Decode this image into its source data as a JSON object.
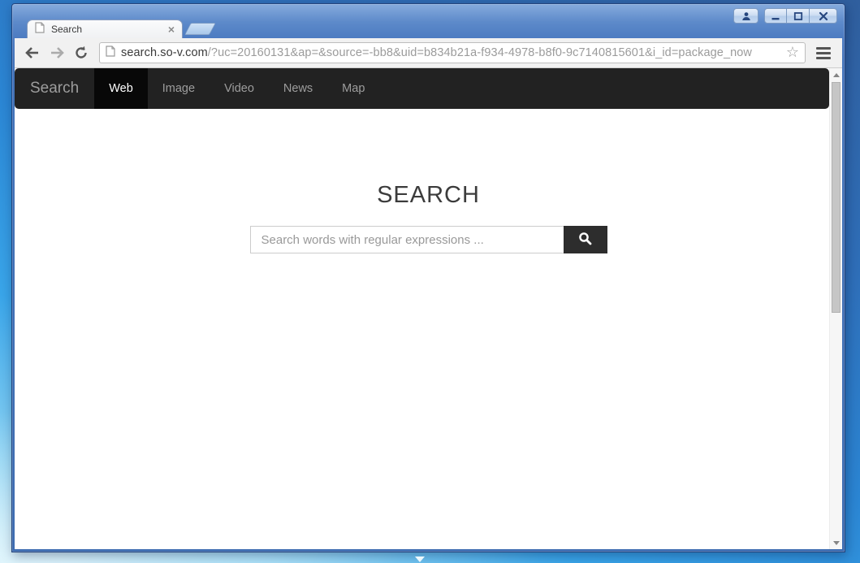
{
  "window": {
    "tab": {
      "title": "Search",
      "close_glyph": "×"
    },
    "controls": {
      "profile_icon": "person",
      "minimize_icon": "minimize-dash",
      "maximize_icon": "maximize-box",
      "close_icon": "close-x"
    }
  },
  "toolbar": {
    "back_icon": "arrow-left",
    "forward_icon": "arrow-right",
    "reload_icon": "refresh-circle-arrow",
    "favicon": "document-page",
    "url_host": "search.so-v.com",
    "url_rest": "/?uc=20160131&ap=&source=-bb8&uid=b834b21a-f934-4978-b8f0-9c7140815601&i_id=package_now",
    "bookmark_icon": "star-outline",
    "bookmark_glyph": "☆",
    "menu_icon": "hamburger"
  },
  "navbar": {
    "brand": "Search",
    "items": [
      {
        "label": "Web",
        "active": true
      },
      {
        "label": "Image",
        "active": false
      },
      {
        "label": "Video",
        "active": false
      },
      {
        "label": "News",
        "active": false
      },
      {
        "label": "Map",
        "active": false
      }
    ]
  },
  "main": {
    "heading": "SEARCH",
    "search_placeholder": "Search words with regular expressions ...",
    "search_value": "",
    "search_icon": "magnifier"
  },
  "colors": {
    "navbar_bg": "#222222",
    "navbar_active_bg": "#080808",
    "navbar_text": "#9d9d9d",
    "search_button_bg": "#2d2d2d",
    "titlebar_blue": "#4c7bc1",
    "desktop_blue": "#2b86d4"
  }
}
